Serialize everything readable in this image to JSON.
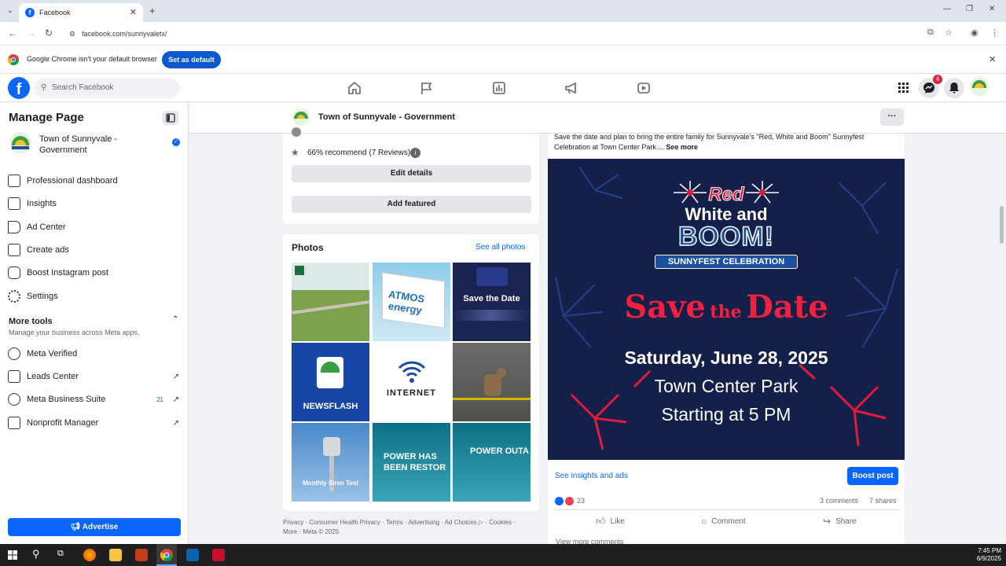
{
  "browser": {
    "tab_title": "Facebook",
    "url": "facebook.com/sunnyvaletx/",
    "banner_text": "Google Chrome isn't your default browser",
    "banner_button": "Set as default"
  },
  "fb": {
    "search_placeholder": "Search Facebook",
    "notification_count": "4"
  },
  "sidebar": {
    "title": "Manage Page",
    "page_name": "Town of Sunnyvale - Government",
    "items": [
      {
        "label": "Professional dashboard",
        "icon": "dashboard-icon"
      },
      {
        "label": "Insights",
        "icon": "insights-icon"
      },
      {
        "label": "Ad Center",
        "icon": "megaphone-icon"
      },
      {
        "label": "Create ads",
        "icon": "edit-icon"
      },
      {
        "label": "Boost Instagram post",
        "icon": "instagram-icon"
      },
      {
        "label": "Settings",
        "icon": "gear-icon"
      }
    ],
    "more_tools_title": "More tools",
    "more_tools_sub": "Manage your business across Meta apps.",
    "tools": [
      {
        "label": "Meta Verified",
        "badge": "",
        "external": false
      },
      {
        "label": "Leads Center",
        "badge": "",
        "external": true
      },
      {
        "label": "Meta Business Suite",
        "badge": "21",
        "external": true
      },
      {
        "label": "Nonprofit Manager",
        "badge": "",
        "external": true
      }
    ],
    "advertise_label": "Advertise"
  },
  "page_header": {
    "name": "Town of Sunnyvale - Government",
    "more": "···"
  },
  "intro": {
    "recommend": "66% recommend (7 Reviews)",
    "edit_details": "Edit details",
    "add_featured": "Add featured"
  },
  "photos": {
    "title": "Photos",
    "see_all": "See all photos",
    "tiles": [
      {
        "caption": ""
      },
      {
        "caption": "ATMOS energy"
      },
      {
        "caption": "Save the Date"
      },
      {
        "caption": "NEWSFLASH"
      },
      {
        "caption": "INTERNET"
      },
      {
        "caption": ""
      },
      {
        "caption": "Monthly Siren Test"
      },
      {
        "caption": "POWER HAS BEEN RESTOR"
      },
      {
        "caption": "POWER OUTA"
      }
    ]
  },
  "footer": {
    "links": "Privacy · Consumer Health Privacy · Terms · Advertising · Ad Choices ▷ · Cookies ·",
    "links2": "More · Meta © 2025"
  },
  "post": {
    "text": "Save the date and plan to bring the entire family for Sunnyvale's \"Red, White and Boom\" Sunnyfest Celebration at Town Center Park....",
    "see_more": "See more",
    "flyer": {
      "logo_red": "Red",
      "logo_white": "White and",
      "logo_boom": "BOOM!",
      "logo_banner": "SUNNYFEST CELEBRATION",
      "save": "Save",
      "the": "the",
      "date": "Date",
      "line1": "Saturday, June 28, 2025",
      "line2": "Town Center Park",
      "line3": "Starting at 5 PM"
    },
    "insights_link": "See insights and ads",
    "boost_button": "Boost post",
    "reaction_count": "23",
    "comments": "3 comments",
    "shares": "7 shares",
    "like": "Like",
    "comment": "Comment",
    "share": "Share",
    "view_more": "View more comments"
  },
  "taskbar": {
    "time": "7:45 PM",
    "date": "6/9/2025"
  },
  "colors": {
    "fb_blue": "#0866ff",
    "chrome_blue": "#0b57d0",
    "flyer_navy": "#14204a",
    "flyer_red": "#e21b3c"
  }
}
